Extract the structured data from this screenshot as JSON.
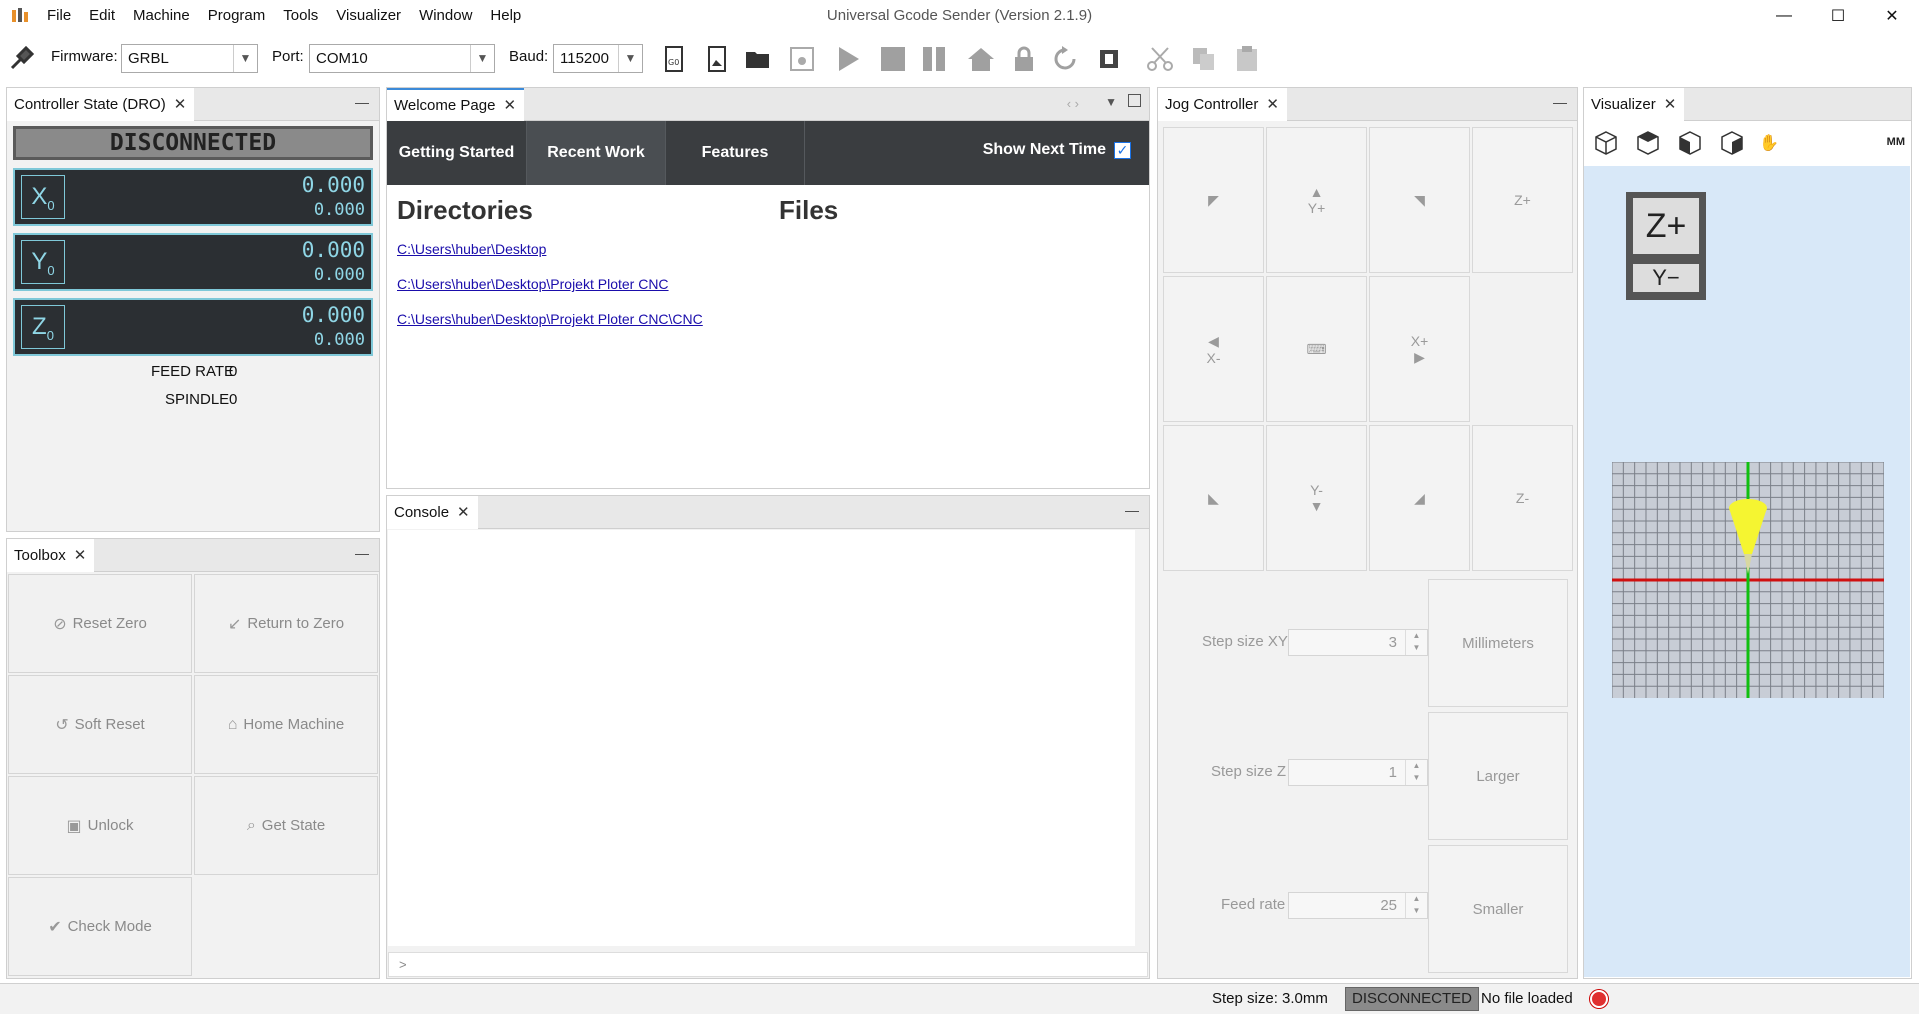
{
  "window": {
    "title": "Universal Gcode Sender (Version 2.1.9)",
    "minimize": "—",
    "maximize": "☐",
    "close": "✕"
  },
  "menu": [
    "File",
    "Edit",
    "Machine",
    "Program",
    "Tools",
    "Visualizer",
    "Window",
    "Help"
  ],
  "toolbar": {
    "firmware_label": "Firmware:",
    "firmware_value": "GRBL",
    "port_label": "Port:",
    "port_value": "COM10",
    "baud_label": "Baud:",
    "baud_value": "115200",
    "icons": [
      "connect-icon",
      "gcode-icon",
      "open-image-icon",
      "open-folder-icon",
      "save-icon",
      "play-icon",
      "stop-icon",
      "pause-icon",
      "home-icon",
      "lock-icon",
      "reset-icon",
      "probe-icon",
      "cut-icon",
      "copy-icon",
      "paste-icon"
    ]
  },
  "dro": {
    "tab": "Controller State (DRO)",
    "state": "DISCONNECTED",
    "axes": [
      {
        "letter": "X",
        "sub": "0",
        "work": "0.000",
        "machine": "0.000"
      },
      {
        "letter": "Y",
        "sub": "0",
        "work": "0.000",
        "machine": "0.000"
      },
      {
        "letter": "Z",
        "sub": "0",
        "work": "0.000",
        "machine": "0.000"
      }
    ],
    "feed_label": "FEED RATE",
    "feed_value": "0",
    "spindle_label": "SPINDLE",
    "spindle_value": "0"
  },
  "toolbox": {
    "tab": "Toolbox",
    "buttons": [
      "Reset Zero",
      "Return to Zero",
      "Soft Reset",
      "Home Machine",
      "Unlock",
      "Get State",
      "Check Mode"
    ]
  },
  "welcome": {
    "tab": "Welcome Page",
    "tabs": [
      "Getting Started",
      "Recent Work",
      "Features"
    ],
    "show_next": "Show Next Time",
    "directories_heading": "Directories",
    "files_heading": "Files",
    "directories": [
      "C:\\Users\\huber\\Desktop",
      "C:\\Users\\huber\\Desktop\\Projekt Ploter CNC",
      "C:\\Users\\huber\\Desktop\\Projekt Ploter CNC\\CNC"
    ]
  },
  "console": {
    "tab": "Console",
    "prompt": ">"
  },
  "jog": {
    "tab": "Jog Controller",
    "yplus": "Y+",
    "yminus": "Y-",
    "xplus": "X+",
    "xminus": "X-",
    "zplus": "Z+",
    "zminus": "Z-",
    "step_xy_label": "Step size XY",
    "step_xy": "3",
    "step_z_label": "Step size Z",
    "step_z": "1",
    "feed_label": "Feed rate",
    "feed": "25",
    "units": "Millimeters",
    "larger": "Larger",
    "smaller": "Smaller"
  },
  "visualizer": {
    "tab": "Visualizer",
    "units": "MM",
    "cube_top": "Z+",
    "cube_bottom": "Y−"
  },
  "status": {
    "step_size": "Step size: 3.0mm",
    "state": "DISCONNECTED",
    "file": "No file loaded"
  }
}
